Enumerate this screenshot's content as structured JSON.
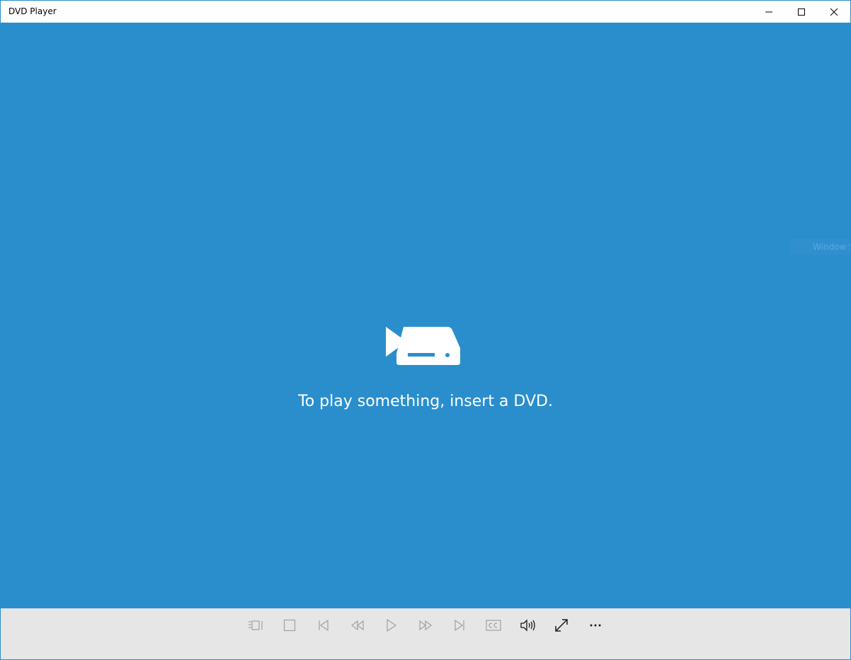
{
  "window": {
    "title": "DVD Player"
  },
  "titlebar_buttons": [
    {
      "name": "minimize",
      "icon": "minimize-icon"
    },
    {
      "name": "maximize",
      "icon": "maximize-icon"
    },
    {
      "name": "close",
      "icon": "close-icon"
    }
  ],
  "main": {
    "message": "To play something, insert a DVD.",
    "icon": "dvd-drive-icon",
    "side_hint": "Window S"
  },
  "controls": [
    {
      "name": "chapters",
      "icon": "chapters-icon",
      "enabled": false
    },
    {
      "name": "stop",
      "icon": "stop-icon",
      "enabled": false
    },
    {
      "name": "previous",
      "icon": "previous-icon",
      "enabled": false
    },
    {
      "name": "rewind",
      "icon": "rewind-icon",
      "enabled": false
    },
    {
      "name": "play",
      "icon": "play-icon",
      "enabled": false
    },
    {
      "name": "fast-forward",
      "icon": "fast-forward-icon",
      "enabled": false
    },
    {
      "name": "next",
      "icon": "next-icon",
      "enabled": false
    },
    {
      "name": "closed-captions",
      "icon": "closed-captions-icon",
      "enabled": false
    },
    {
      "name": "volume",
      "icon": "volume-icon",
      "enabled": true
    },
    {
      "name": "full-screen",
      "icon": "full-screen-icon",
      "enabled": true
    },
    {
      "name": "more-options",
      "icon": "more-options-icon",
      "enabled": true
    }
  ],
  "colors": {
    "content_background": "#2a8ecd",
    "controls_background": "#e6e6e6",
    "disabled_icon": "#a0a0a0",
    "enabled_icon": "#1a1a1a"
  }
}
